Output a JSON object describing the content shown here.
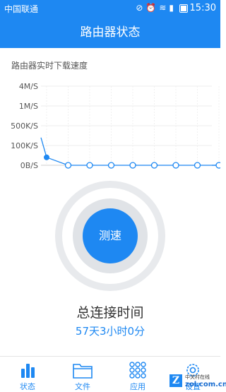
{
  "status_bar": {
    "carrier": "中国联通",
    "time": "15:30",
    "indicator_icons": [
      "mute-icon",
      "alarm-icon",
      "wifi-icon",
      "signal-icon",
      "battery-icon"
    ]
  },
  "header": {
    "title": "路由器状态"
  },
  "chart_title": "路由器实时下载速度",
  "chart_data": {
    "type": "line",
    "title": "路由器实时下载速度",
    "y_tick_labels": [
      "4M/S",
      "1M/S",
      "500K/S",
      "100K/S",
      "0B/S"
    ],
    "y_tick_values_kbps": [
      4096,
      1024,
      500,
      100,
      0
    ],
    "y_scale": "nonlinear (ticks evenly spaced)",
    "x": [
      0,
      1,
      2,
      3,
      4,
      5,
      6,
      7,
      8
    ],
    "series": [
      {
        "values": [
          40,
          0,
          0,
          0,
          0,
          0,
          0,
          0,
          0
        ],
        "color": "#1e88f2",
        "unit": "K/S"
      }
    ],
    "grid": true
  },
  "speed_test": {
    "button_label": "测速"
  },
  "connection": {
    "label": "总连接时间",
    "value": "57天3小时0分"
  },
  "tabs": [
    {
      "label": "状态",
      "icon": "bar-chart-icon"
    },
    {
      "label": "文件",
      "icon": "folder-icon"
    },
    {
      "label": "应用",
      "icon": "apps-grid-icon"
    },
    {
      "label": "设置",
      "icon": "gear-icon"
    }
  ],
  "watermark": {
    "line1": "中关村在线",
    "line2": "zol.com.cn",
    "logo_letter": "Z"
  },
  "colors": {
    "accent": "#1e88f2",
    "ring": "#e8eaed"
  }
}
